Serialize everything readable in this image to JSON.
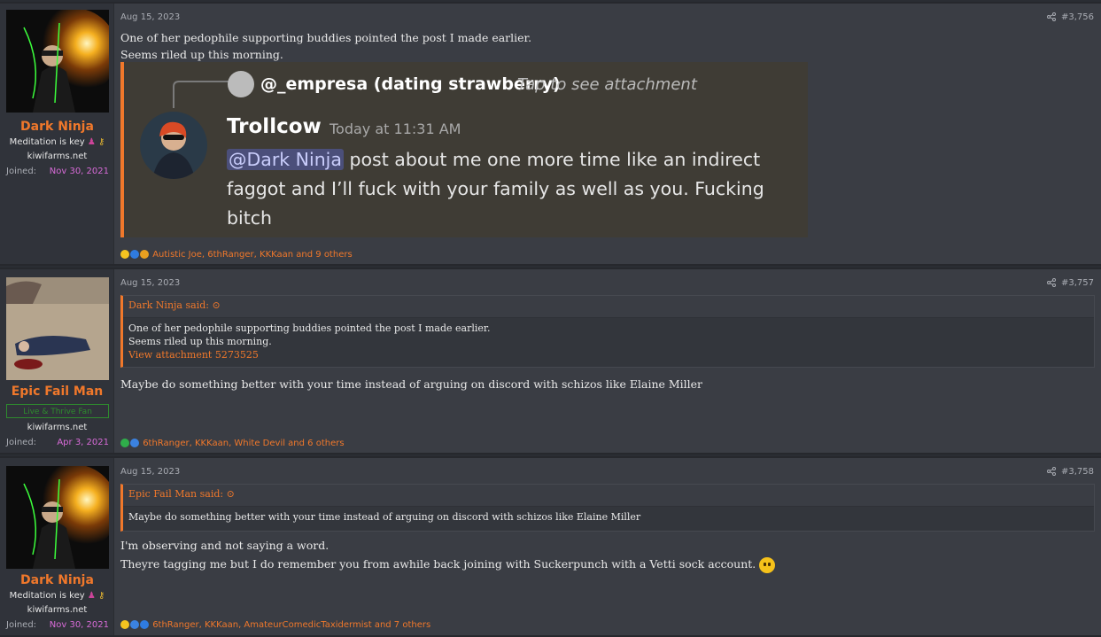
{
  "colors": {
    "accent": "#f0782b",
    "joined": "#d86bd8",
    "banner": "#2e8b2e"
  },
  "posts": [
    {
      "username": "Dark Ninja",
      "user_title": "Meditation is key",
      "site": "kiwifarms.net",
      "joined_label": "Joined:",
      "joined_date": "Nov 30, 2021",
      "date": "Aug 15, 2023",
      "post_number": "#3,756",
      "lines": [
        "One of her pedophile supporting buddies pointed the post I made earlier.",
        "Seems riled up this morning."
      ],
      "attachment": {
        "reply_user": "@_empresa (dating strawberry)",
        "reply_hint": "Tap to see attachment",
        "author": "Trollcow",
        "timestamp": "Today at 11:31 AM",
        "mention": "@Dark Ninja",
        "message_line1": " post about me one more time like an indirect",
        "message_line2": "faggot and I’ll fuck with your family as well as you. Fucking",
        "message_line3": "bitch"
      },
      "reactions": "Autistic Joe, 6thRanger, KKKaan and 9 others",
      "reaction_icons": [
        "thinking-icon",
        "info-icon",
        "clap-icon"
      ]
    },
    {
      "username": "Epic Fail Man",
      "banner": "Live & Thrive Fan",
      "site": "kiwifarms.net",
      "joined_label": "Joined:",
      "joined_date": "Apr 3, 2021",
      "date": "Aug 15, 2023",
      "post_number": "#3,757",
      "quote": {
        "header": "Dark Ninja said:",
        "lines": [
          "One of her pedophile supporting buddies pointed the post I made earlier.",
          "Seems riled up this morning."
        ],
        "link": "View attachment 5273525"
      },
      "lines": [
        "Maybe do something better with your time instead of arguing on discord with schizos like Elaine Miller"
      ],
      "reactions": "6thRanger, KKKaan, White Devil and 6 others",
      "reaction_icons": [
        "check-icon",
        "thumbs-up-icon"
      ]
    },
    {
      "username": "Dark Ninja",
      "user_title": "Meditation is key",
      "site": "kiwifarms.net",
      "joined_label": "Joined:",
      "joined_date": "Nov 30, 2021",
      "date": "Aug 15, 2023",
      "post_number": "#3,758",
      "quote": {
        "header": "Epic Fail Man said:",
        "lines": [
          "Maybe do something better with your time instead of arguing on discord with schizos like Elaine Miller"
        ]
      },
      "lines": [
        "I'm observing and not saying a word.",
        "Theyre tagging me but I do remember you from awhile back joining with Suckerpunch with a Vetti sock account."
      ],
      "reactions": "6thRanger, KKKaan, AmateurComedicTaxidermist and 7 others",
      "reaction_icons": [
        "thinking-icon",
        "thumbs-up-icon",
        "info-icon"
      ]
    }
  ]
}
